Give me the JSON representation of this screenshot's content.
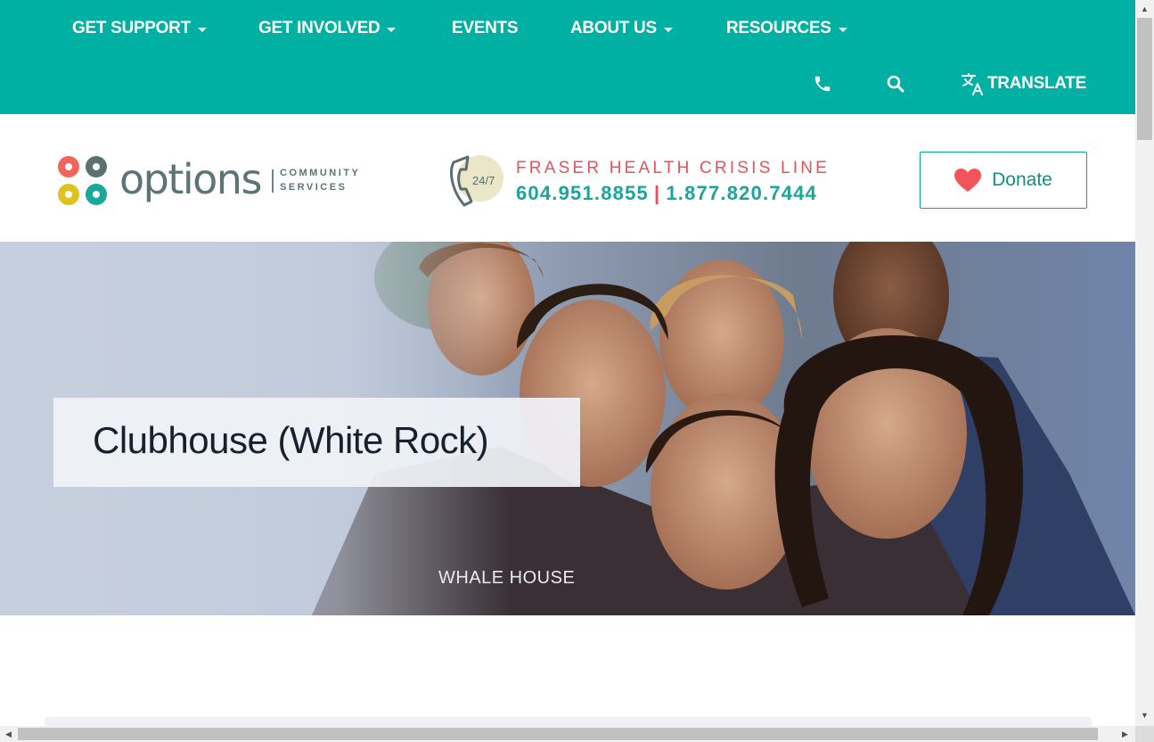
{
  "nav": {
    "items": [
      {
        "label": "GET SUPPORT",
        "dropdown": true
      },
      {
        "label": "GET INVOLVED",
        "dropdown": true
      },
      {
        "label": "EVENTS",
        "dropdown": false
      },
      {
        "label": "ABOUT US",
        "dropdown": true
      },
      {
        "label": "RESOURCES",
        "dropdown": true
      }
    ],
    "utility": {
      "phone_icon": "phone-icon",
      "search_icon": "search-icon",
      "translate_icon": "translate-icon",
      "translate_label": "TRANSLATE"
    }
  },
  "header": {
    "logo": {
      "word": "options",
      "sub_line1": "COMMUNITY",
      "sub_line2": "SERVICES"
    },
    "crisis": {
      "badge": "24/7",
      "title": "FRASER HEALTH CRISIS LINE",
      "phone_1": "604.951.8855",
      "separator": "|",
      "phone_2": "1.877.820.7444"
    },
    "donate": {
      "label": "Donate",
      "icon": "heart-icon"
    }
  },
  "hero": {
    "title": "Clubhouse (White Rock)",
    "caption": "WHALE HOUSE"
  },
  "colors": {
    "teal": "#00b0a3",
    "teal_text": "#1aa59a",
    "coral": "#e8505b",
    "heart": "#f2545b"
  }
}
